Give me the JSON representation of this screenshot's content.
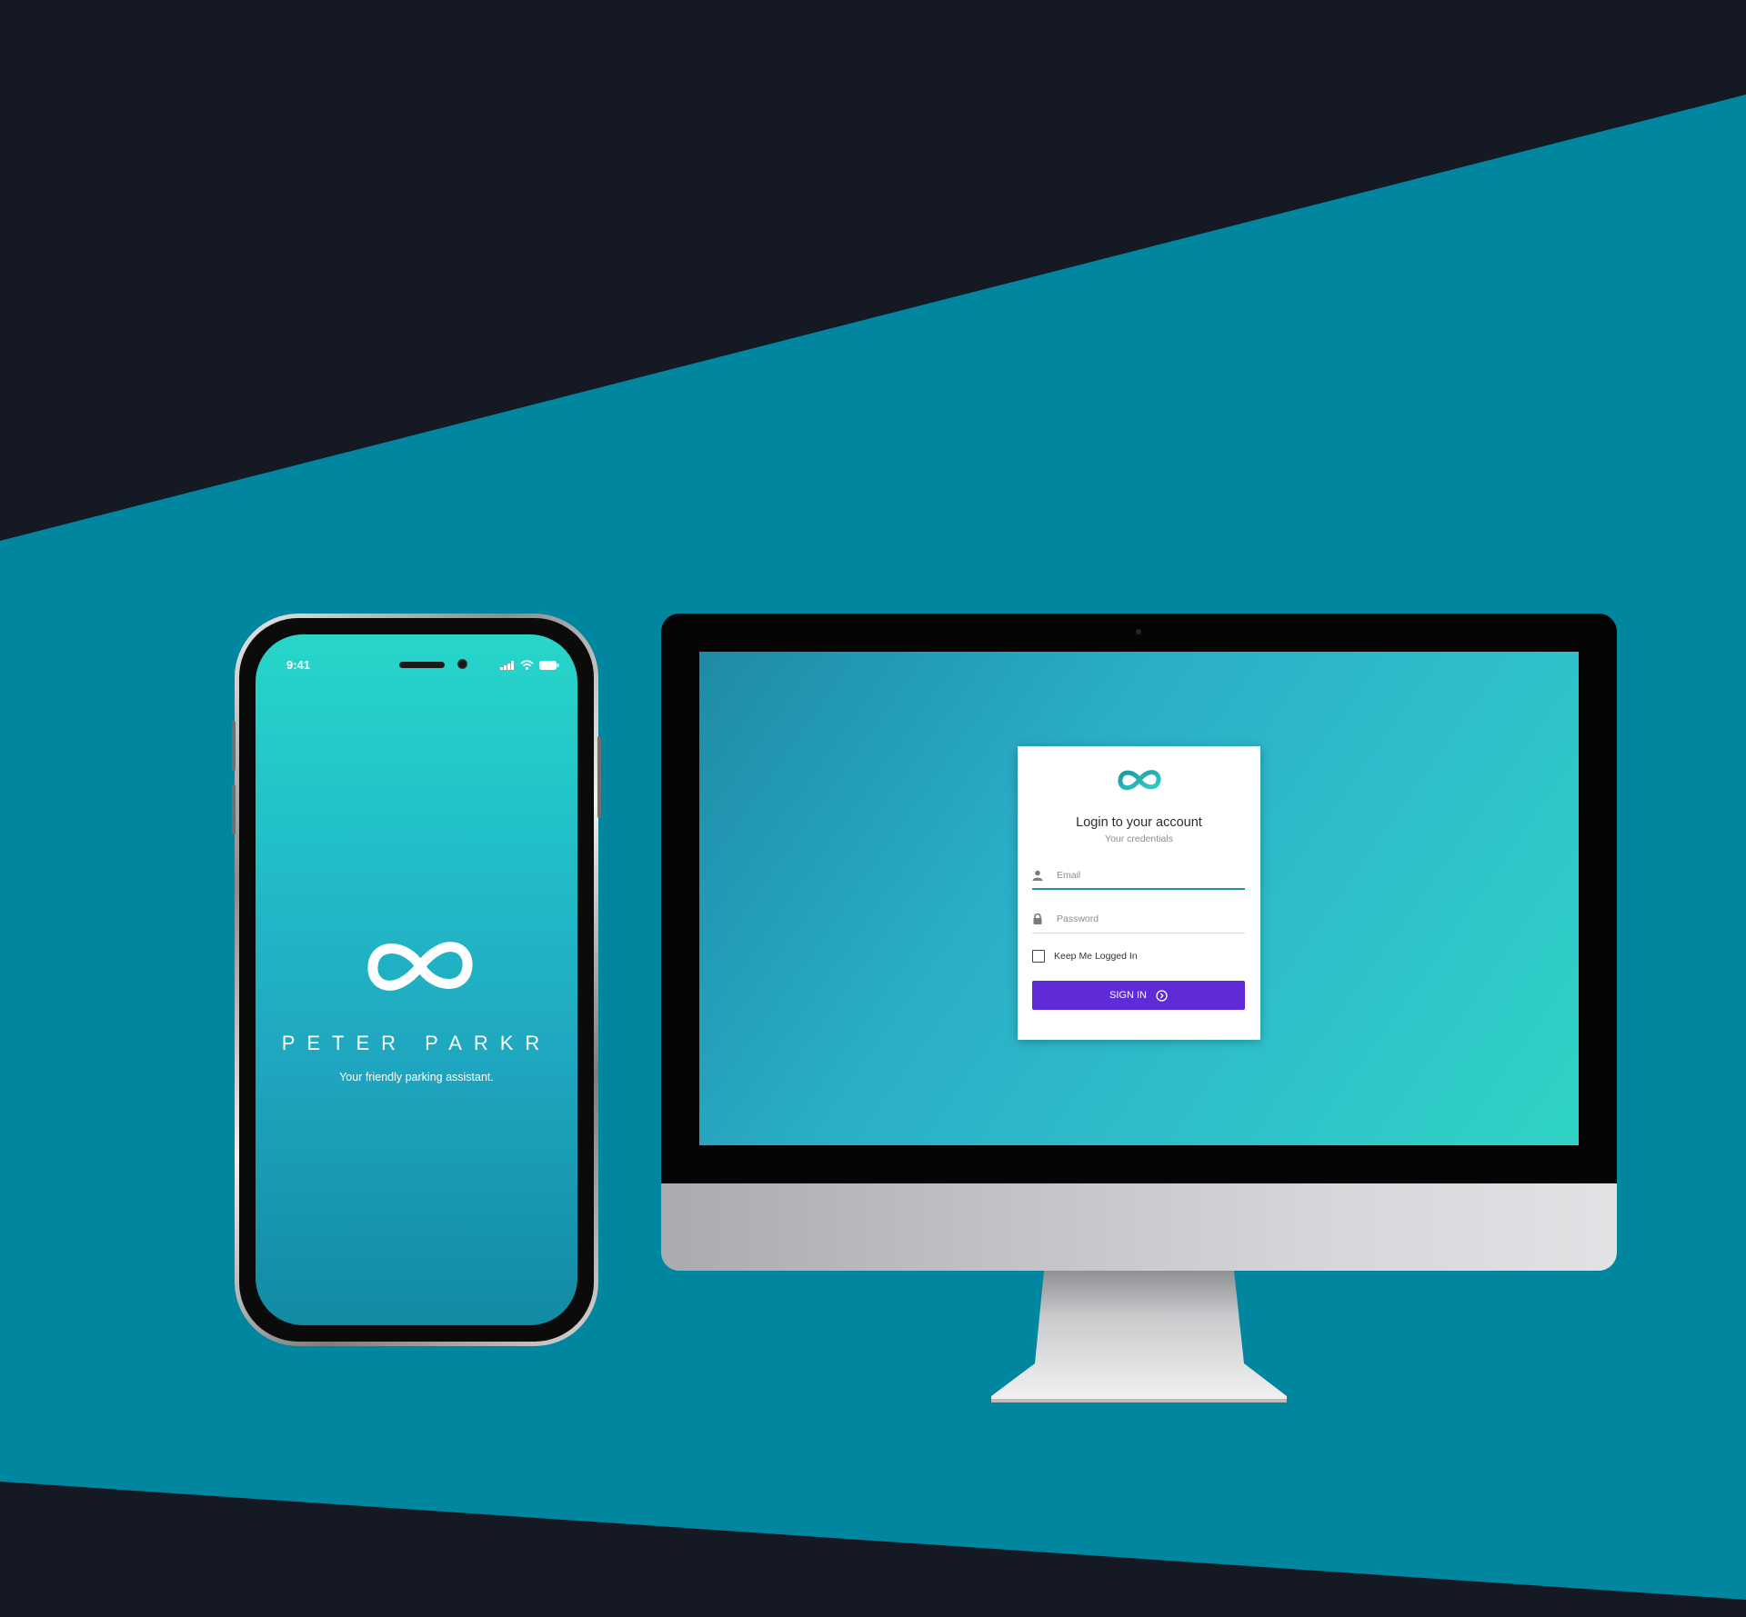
{
  "colors": {
    "background_dark": "#141923",
    "background_teal": "#00869f",
    "brand_teal": "#27d6c9",
    "signin_purple": "#5f2bd6",
    "focus_underline": "#1c97a0"
  },
  "phone": {
    "status_time": "9:41",
    "status_icons": [
      "signal-icon",
      "wifi-icon",
      "battery-icon"
    ],
    "brand_name": "PETER PARKR",
    "tagline": "Your friendly parking assistant.",
    "logo_icon": "infinity-logo-icon"
  },
  "desktop": {
    "login": {
      "logo_icon": "infinity-logo-icon",
      "title": "Login to your account",
      "subtitle": "Your credentials",
      "email": {
        "placeholder": "Email",
        "value": "",
        "icon": "user-icon"
      },
      "password": {
        "placeholder": "Password",
        "value": "",
        "icon": "lock-icon"
      },
      "remember_label": "Keep Me Logged In",
      "remember_checked": false,
      "signin_label": "SIGN IN",
      "signin_icon": "arrow-circle-right-icon"
    }
  }
}
